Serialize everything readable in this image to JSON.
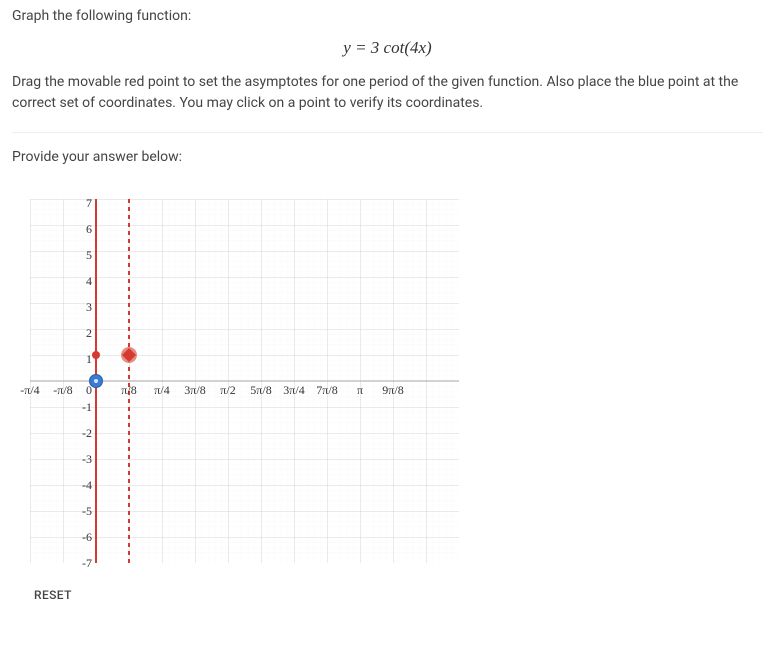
{
  "problem": {
    "title": "Graph the following function:",
    "equation": "y = 3 cot(4x)",
    "instructions": "Drag the movable red point to set the asymptotes for one period of the given function. Also place the blue point at the correct set of coordinates. You may click on a point to verify its coordinates.",
    "prompt": "Provide your answer below:",
    "reset_label": "RESET"
  },
  "chart_data": {
    "type": "line",
    "title": "",
    "xlabel": "",
    "ylabel": "",
    "xlim": [
      "-π/4",
      "9π/8"
    ],
    "ylim": [
      -7,
      7
    ],
    "x_ticks": [
      "-π/4",
      "-π/8",
      "0",
      "π/8",
      "π/4",
      "3π/8",
      "π/2",
      "5π/8",
      "3π/4",
      "7π/8",
      "π",
      "9π/8"
    ],
    "y_ticks": [
      -7,
      -6,
      -5,
      -4,
      -3,
      -2,
      -1,
      0,
      1,
      2,
      3,
      4,
      5,
      6,
      7
    ],
    "asymptotes": [
      {
        "x": "0",
        "color": "red"
      },
      {
        "x": "π/8",
        "color": "red"
      }
    ],
    "points": [
      {
        "name": "red-point-left",
        "x": "0",
        "y": 1,
        "color": "red"
      },
      {
        "name": "red-point-right",
        "x": "π/8",
        "y": 1,
        "color": "red"
      },
      {
        "name": "blue-point",
        "x": "0",
        "y": 0,
        "color": "blue"
      }
    ]
  }
}
